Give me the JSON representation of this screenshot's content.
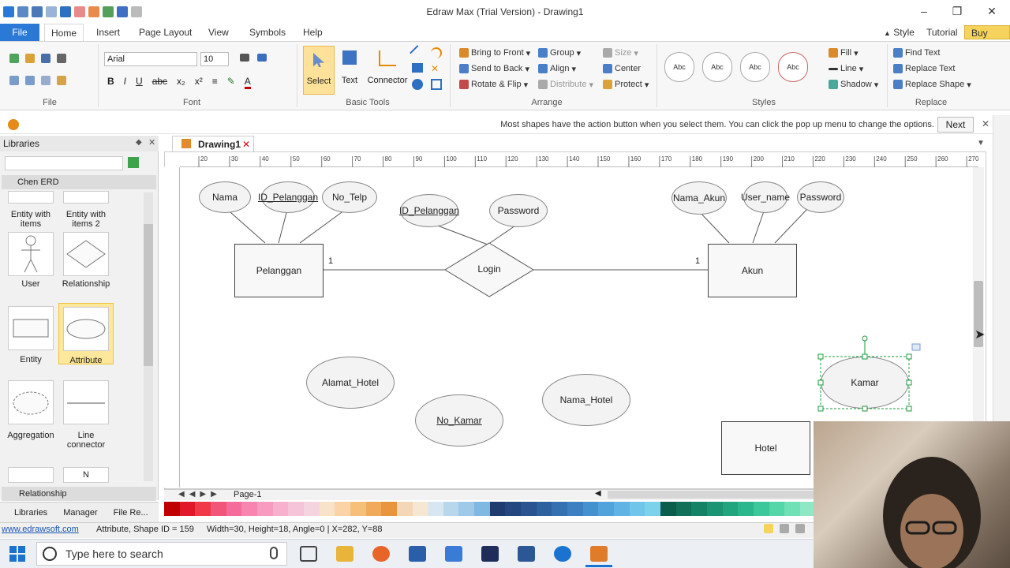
{
  "app": {
    "title": "Edraw Max (Trial Version) - Drawing1"
  },
  "ribbon_tabs": [
    "File",
    "Home",
    "Insert",
    "Page Layout",
    "View",
    "Symbols",
    "Help"
  ],
  "ribbon_right": {
    "style": "Style",
    "tutorial": "Tutorial",
    "buy_now": "Buy Now"
  },
  "font": {
    "family": "Arial",
    "size": "10"
  },
  "groups": {
    "file": "File",
    "font": "Font",
    "basic_tools": "Basic Tools",
    "arrange": "Arrange",
    "styles": "Styles",
    "replace": "Replace"
  },
  "basic_tools": {
    "select": "Select",
    "text": "Text",
    "connector": "Connector"
  },
  "arrange": {
    "bring_to_front": "Bring to Front",
    "send_to_back": "Send to Back",
    "rotate_flip": "Rotate & Flip",
    "group": "Group",
    "align": "Align",
    "distribute": "Distribute",
    "size": "Size",
    "center": "Center",
    "protect": "Protect"
  },
  "styles": {
    "sample": "Abc",
    "fill": "Fill",
    "line": "Line",
    "shadow": "Shadow"
  },
  "replace": {
    "find_text": "Find Text",
    "replace_text": "Replace Text",
    "replace_shape": "Replace Shape"
  },
  "infobar": {
    "message": "Most shapes have the action button when you select them. You can click the pop up menu to change the options.",
    "next": "Next"
  },
  "libraries": {
    "title": "Libraries",
    "section": "Chen ERD",
    "items": [
      {
        "label": "Entity with items"
      },
      {
        "label": "Entity with items 2"
      },
      {
        "label": "User"
      },
      {
        "label": "Relationship"
      },
      {
        "label": "Entity"
      },
      {
        "label": "Attribute"
      },
      {
        "label": "Aggregation"
      },
      {
        "label": "Line connector"
      },
      {
        "label": "N"
      }
    ],
    "bottom_section": "Relationship",
    "tabs": [
      "Libraries",
      "Manager",
      "File Re..."
    ]
  },
  "document": {
    "tab": "Drawing1",
    "page": "Page-1",
    "entities": [
      {
        "label": "Pelanggan"
      },
      {
        "label": "Akun"
      },
      {
        "label": "Hotel"
      }
    ],
    "relationship": "Login",
    "cardinality": [
      "1",
      "1"
    ],
    "attributes": {
      "nama": "Nama",
      "id_pelanggan_1": "ID_Pelanggan",
      "no_telp": "No_Telp",
      "id_pelanggan_2": "ID_Pelanggan",
      "password": "Password",
      "nama_akun": "Nama_Akun",
      "user_name": "User_name",
      "password_akun": "Password",
      "alamat_hotel": "Alamat_Hotel",
      "no_kamar": "No_Kamar",
      "nama_hotel": "Nama_Hotel",
      "kamar": "Kamar"
    },
    "ruler_ticks": [
      "20",
      "30",
      "40",
      "50",
      "60",
      "70",
      "80",
      "90",
      "100",
      "110",
      "120",
      "130",
      "140",
      "150",
      "160",
      "170",
      "180",
      "190",
      "200",
      "210",
      "220",
      "230",
      "240",
      "250",
      "260",
      "270"
    ]
  },
  "status": {
    "website": "www.edrawsoft.com",
    "shape_info": "Attribute, Shape ID = 159",
    "geometry": "Width=30, Height=18, Angle=0 | X=282, Y=88"
  },
  "taskbar": {
    "search_placeholder": "Type here to search"
  },
  "colors": {
    "accent": "#2b79d6",
    "buy_now": "#f6d35c",
    "selection": "#1a9e3a"
  }
}
